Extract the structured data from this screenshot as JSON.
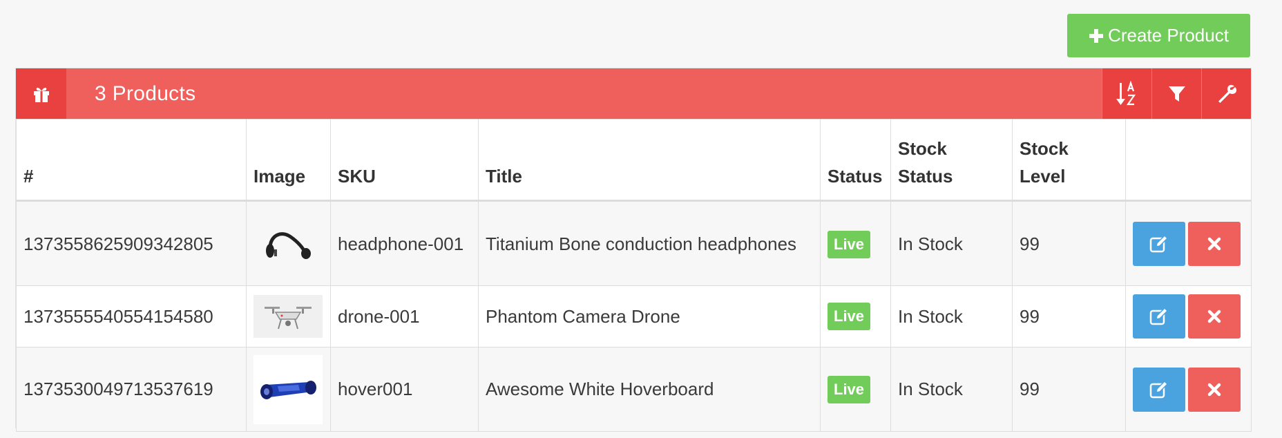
{
  "toolbar": {
    "create_label": "Create Product"
  },
  "panel": {
    "title": "3 Products",
    "header_icon": "gift-icon",
    "tools": [
      "sort-alpha-icon",
      "filter-icon",
      "wrench-icon"
    ]
  },
  "table": {
    "columns": [
      "#",
      "Image",
      "SKU",
      "Title",
      "Status",
      "Stock Status",
      "Stock Level",
      ""
    ],
    "rows": [
      {
        "id": "1373558625909342805",
        "image": "headphones",
        "sku": "headphone-001",
        "title": "Titanium Bone conduction headphones",
        "status": "Live",
        "stock_status": "In Stock",
        "stock_level": "99"
      },
      {
        "id": "1373555540554154580",
        "image": "drone",
        "sku": "drone-001",
        "title": "Phantom Camera Drone",
        "status": "Live",
        "stock_status": "In Stock",
        "stock_level": "99"
      },
      {
        "id": "1373530049713537619",
        "image": "hoverboard",
        "sku": "hover001",
        "title": "Awesome White Hoverboard",
        "status": "Live",
        "stock_status": "In Stock",
        "stock_level": "99"
      }
    ]
  },
  "colors": {
    "header": "#ef5f5b",
    "header_dark": "#e8413f",
    "create": "#72cc5a",
    "edit": "#4aa3df",
    "delete": "#ef5f5b",
    "live": "#72cc5a"
  }
}
